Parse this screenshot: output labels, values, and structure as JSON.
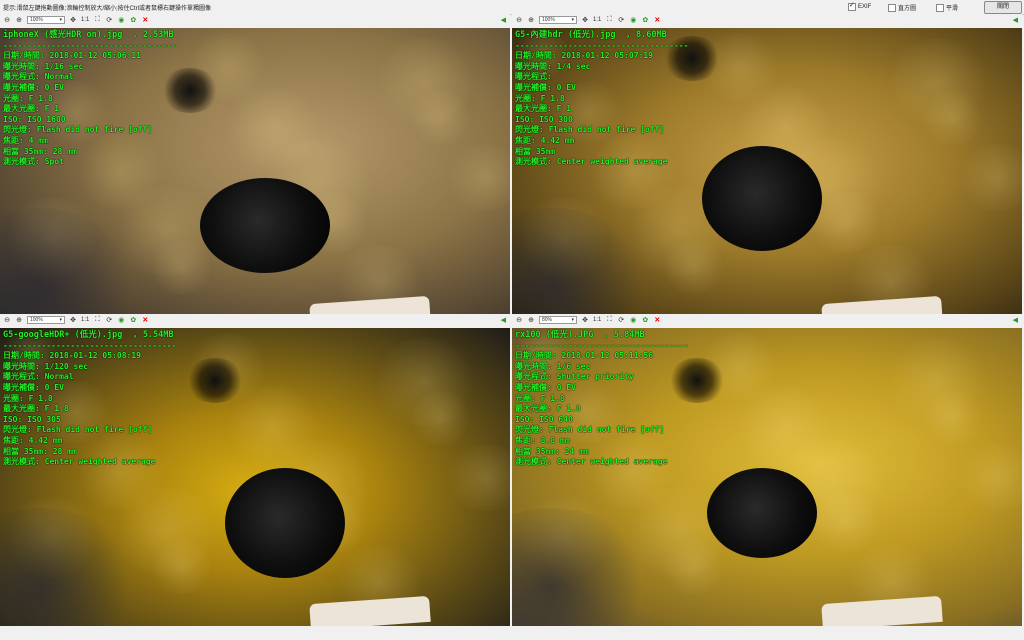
{
  "topbar": {
    "hint": "提示:滑鼠左鍵拖動圖像;滾輪控制放大/縮小;按住Ctrl或者鼠標右鍵操作單獨圖像",
    "exif_label": "EXIF",
    "histogram_label": "直方圖",
    "smooth_label": "平滑",
    "close_label": "關閉"
  },
  "panes": [
    {
      "zoom": "100%",
      "ratio_label": "1:1",
      "exif": {
        "filename": "iphoneX (感光HDR on).jpg  , 2.53MB",
        "separator": "------------------------------------",
        "lines": [
          "日期/時間: 2018-01-12 05:06:11",
          "曝光時間: 1/16 sec",
          "曝光程式: Normal",
          "曝光補償: 0 EV",
          "光圈: F 1.8",
          "最大光圈: F 1",
          "ISO: ISO 1600",
          "閃光燈: Flash did not fire [off]",
          "焦距: 4 mm",
          "相當 35mm: 28 mm",
          "測光模式: Spot"
        ]
      }
    },
    {
      "zoom": "100%",
      "ratio_label": "1:1",
      "exif": {
        "filename": "G5-內建hdr (低光).jpg  , 8.60MB",
        "separator": "------------------------------------",
        "lines": [
          "日期/時間: 2018-01-12 05:07:19",
          "曝光時間: 1/4 sec",
          "曝光程式:",
          "曝光補償: 0 EV",
          "光圈: F 1.8",
          "最大光圈: F 1",
          "ISO: ISO 300",
          "閃光燈: Flash did not fire [off]",
          "焦距: 4.42 mm",
          "相當 35mm",
          "測光模式: Center weighted average"
        ]
      }
    },
    {
      "zoom": "100%",
      "ratio_label": "1:1",
      "exif": {
        "filename": "G5-googleHDR+ (低光).jpg  , 5.54MB",
        "separator": "------------------------------------",
        "lines": [
          "日期/時間: 2018-01-12 05:08:19",
          "曝光時間: 1/120 sec",
          "曝光程式: Normal",
          "曝光補償: 0 EV",
          "光圈: F 1.8",
          "最大光圈: F 1.8",
          "ISO: ISO 305",
          "閃光燈: Flash did not fire [off]",
          "焦距: 4.42 mm",
          "相當 35mm: 28 mm",
          "測光模式: Center weighted average"
        ]
      }
    },
    {
      "zoom": "80%",
      "ratio_label": "1:1",
      "exif": {
        "filename": "rx100 (低光).JPG  , 5.84MB",
        "separator": "------------------------------------",
        "lines": [
          "日期/時間: 2018-01-12 05:11:56",
          "曝光時間: 1/6 sec",
          "曝光程式: Shutter priority",
          "曝光補償: 0 EV",
          "光圈: F 1.8",
          "最大光圈: F 1.8",
          "ISO: ISO 640",
          "閃光燈: Flash did not fire [off]",
          "焦距: 8.8 mm",
          "相當 35mm: 24 mm",
          "測光模式: Center weighted average"
        ]
      }
    }
  ],
  "toolbar_icons": [
    "zoom-out-icon",
    "zoom-in-icon",
    "zoom-select",
    "move-icon",
    "ratio-1to1",
    "fit-icon",
    "rotate-icon",
    "color-icon",
    "palette-icon",
    "delete-icon"
  ],
  "colors": {
    "exif_text": "#26f026",
    "fur_tones": [
      "#8a6a32",
      "#a98520",
      "#c49a10",
      "#c8a420"
    ]
  }
}
